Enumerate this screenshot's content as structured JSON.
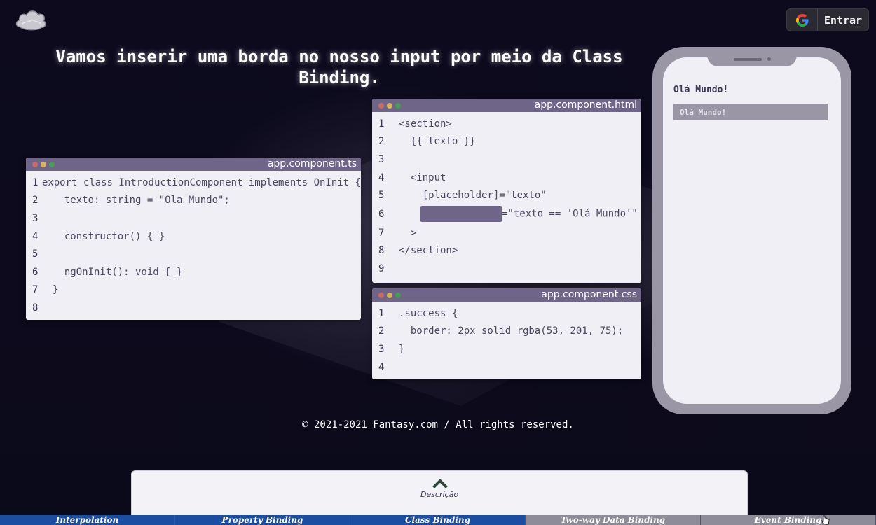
{
  "header": {
    "logo_icon": "cloud-logo-icon",
    "login_label": "Entrar",
    "login_icon": "google-icon"
  },
  "title": "Vamos inserir uma borda no nosso input por meio da Class Binding.",
  "ts_window": {
    "filename": "app.component.ts",
    "lines": [
      {
        "n": "1",
        "code": "export class IntroductionComponent implements OnInit {"
      },
      {
        "n": "2",
        "code": "  texto: string = \"Ola Mundo\";"
      },
      {
        "n": "3",
        "code": ""
      },
      {
        "n": "4",
        "code": "  constructor() { }"
      },
      {
        "n": "5",
        "code": ""
      },
      {
        "n": "6",
        "code": "  ngOnInit(): void { }"
      },
      {
        "n": "7",
        "code": "}"
      },
      {
        "n": "8",
        "code": ""
      }
    ]
  },
  "html_window": {
    "filename": "app.component.html",
    "lines": [
      {
        "n": "1",
        "code": "<section>"
      },
      {
        "n": "2",
        "code": "  {{ texto }}"
      },
      {
        "n": "3",
        "code": ""
      },
      {
        "n": "4",
        "code": "  <input"
      },
      {
        "n": "5",
        "code": "    [placeholder]=\"texto\""
      },
      {
        "n": "6",
        "code": "=\"texto == 'Olá Mundo'\""
      },
      {
        "n": "7",
        "code": "  >"
      },
      {
        "n": "8",
        "code": "</section>"
      },
      {
        "n": "9",
        "code": ""
      }
    ]
  },
  "css_window": {
    "filename": "app.component.css",
    "lines": [
      {
        "n": "1",
        "code": ".success {"
      },
      {
        "n": "2",
        "code": "  border: 2px solid rgba(53, 201, 75);"
      },
      {
        "n": "3",
        "code": "}"
      },
      {
        "n": "4",
        "code": ""
      }
    ]
  },
  "phone": {
    "text": "Olá Mundo!",
    "input_placeholder": "Olá Mundo!"
  },
  "footer": "© 2021-2021 Fantasy.com / All rights reserved.",
  "description": {
    "label": "Descrição",
    "icon": "chevron-up-icon"
  },
  "tabs": [
    {
      "label": "Interpolation",
      "state": "active"
    },
    {
      "label": "Property Binding",
      "state": "active"
    },
    {
      "label": "Class Binding",
      "state": "active"
    },
    {
      "label": "Two-way Data Binding",
      "state": "inactive"
    },
    {
      "label": "Event Binding",
      "state": "inactive"
    }
  ],
  "colors": {
    "window_bar": "#6f6589",
    "window_body": "#f1eff6",
    "tab_active": "#1b4ea0",
    "tab_inactive": "#8e8c98"
  }
}
